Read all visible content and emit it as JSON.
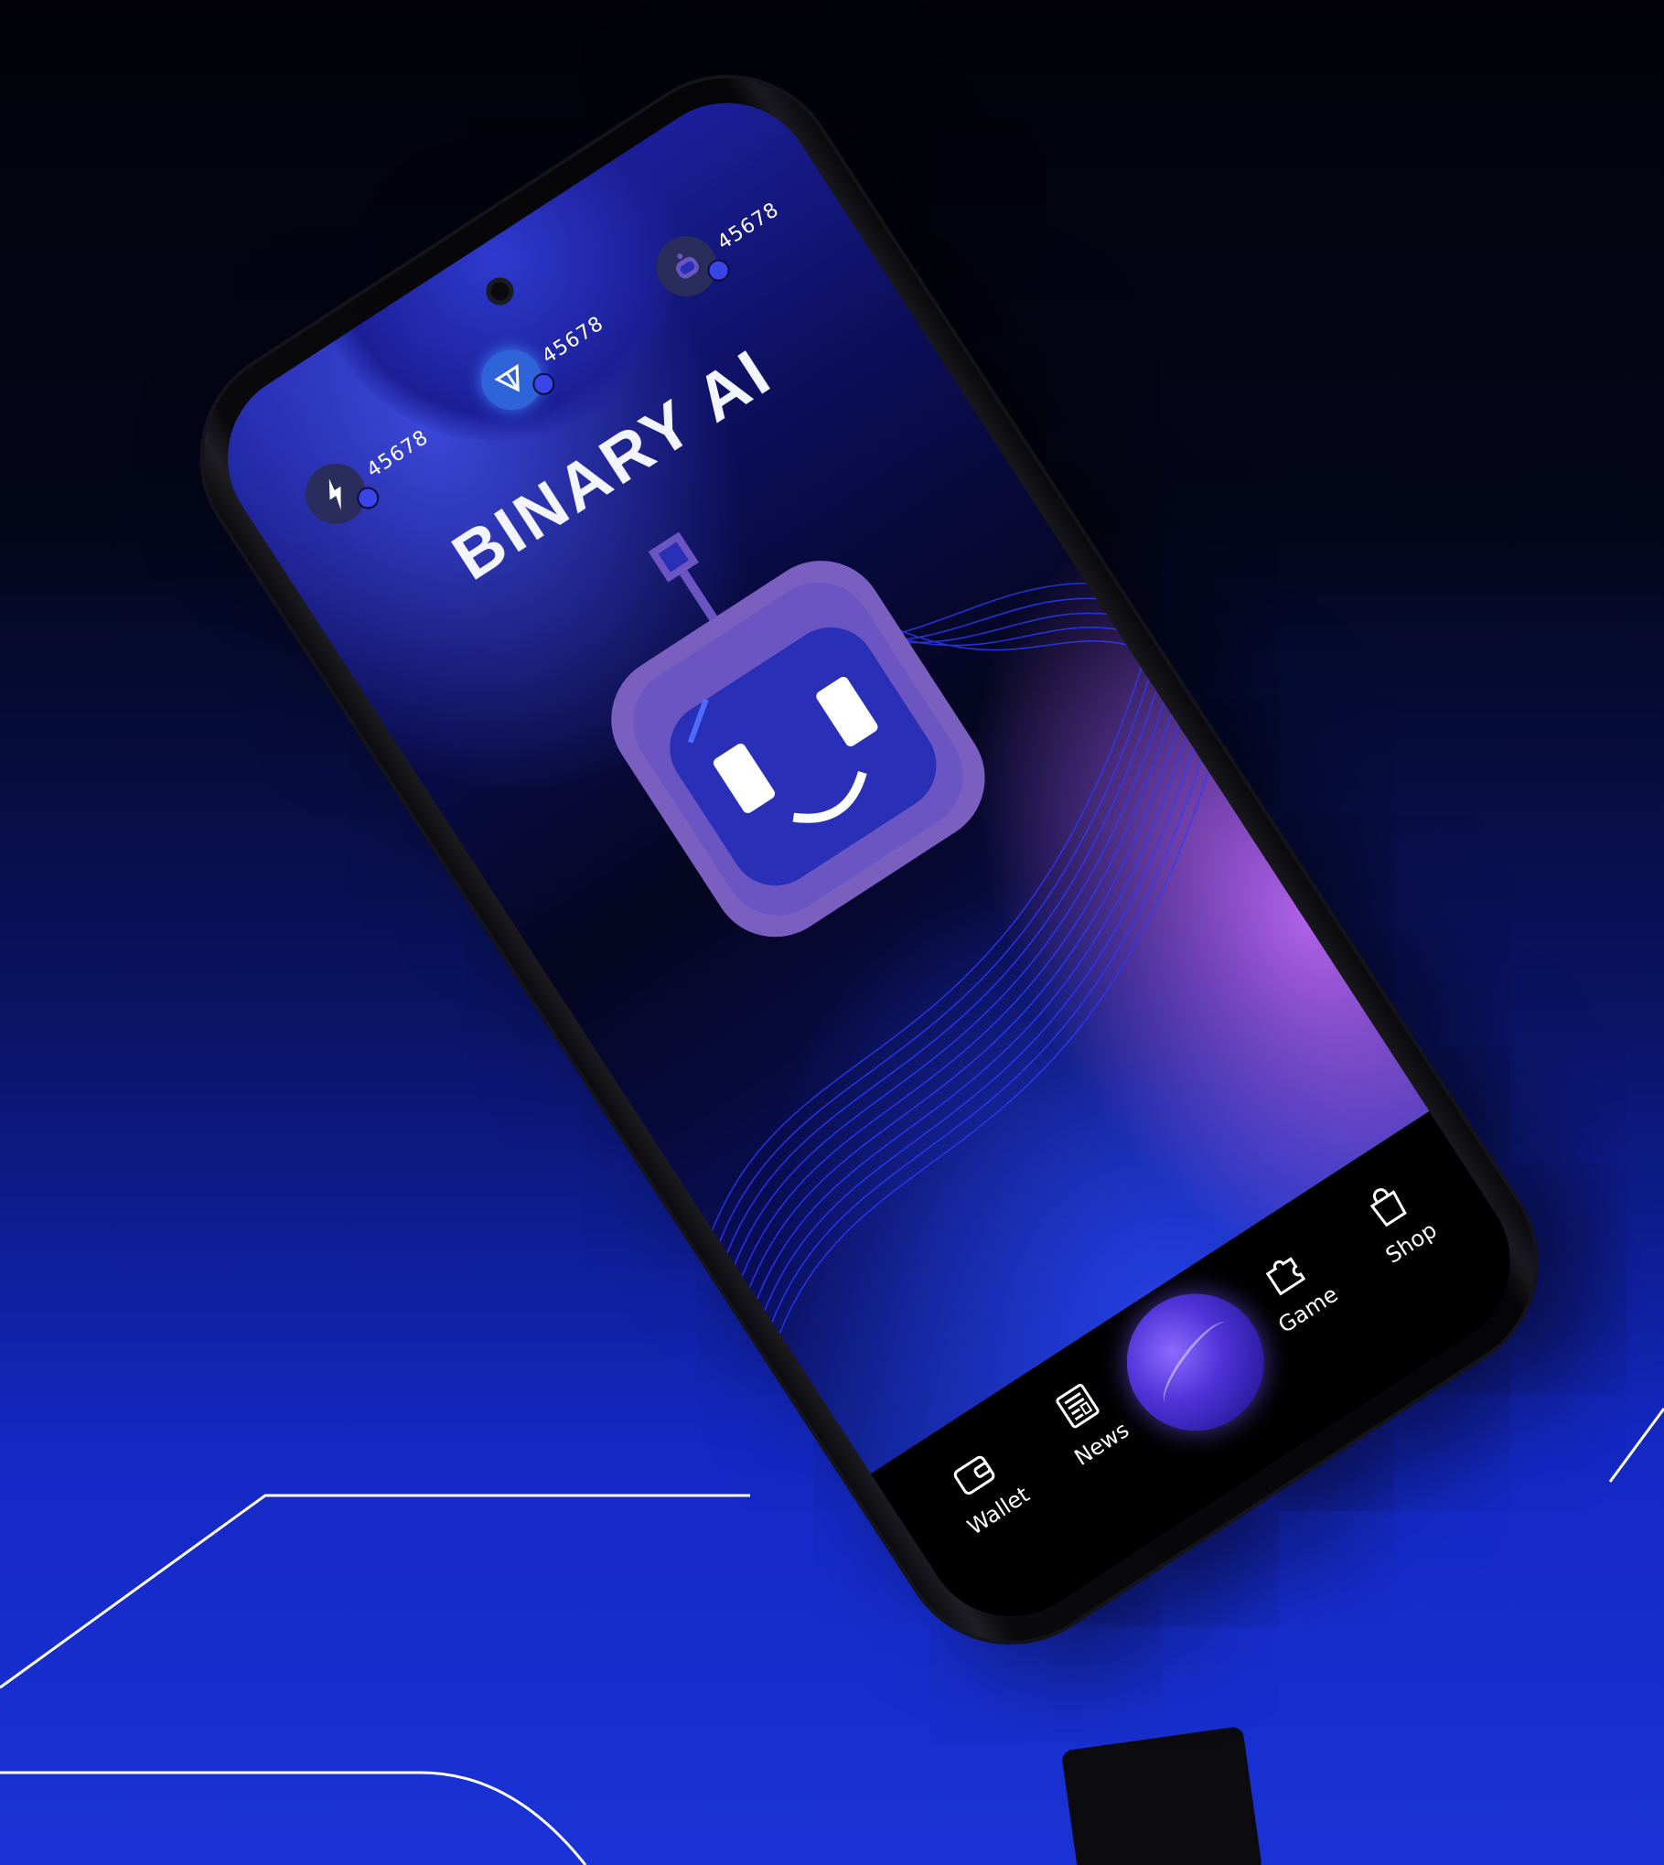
{
  "app": {
    "title": "BINARY AI"
  },
  "stats": [
    {
      "icon": "lightning-icon",
      "value": "45678"
    },
    {
      "icon": "ton-diamond-icon",
      "value": "45678"
    },
    {
      "icon": "robot-coin-icon",
      "value": "45678"
    }
  ],
  "nav": {
    "wallet": "Wallet",
    "news": "News",
    "game": "Game",
    "shop": "Shop"
  },
  "colors": {
    "background_dark": "#020208",
    "background_blue": "#1a33d6",
    "accent_purple": "#8a6bff",
    "robot_purple": "#7a5fc0",
    "robot_face": "#2a2fb8"
  }
}
